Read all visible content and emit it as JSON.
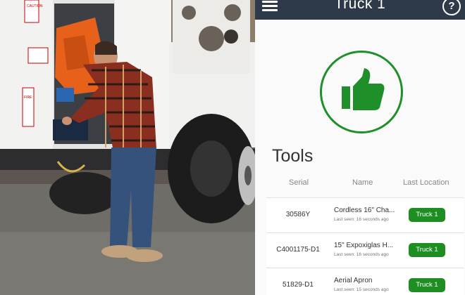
{
  "app": {
    "title": "Truck 1"
  },
  "truck_labels": {
    "caution": "CAUTION",
    "fire": "FIRE"
  },
  "tools": {
    "heading": "Tools",
    "columns": [
      "Serial",
      "Name",
      "Last Location"
    ],
    "rows": [
      {
        "serial": "30586Y",
        "name": "Cordless 16\" Cha...",
        "last_seen": "Last seen: 16 seconds ago",
        "location": "Truck 1"
      },
      {
        "serial": "C4001175-D1",
        "name": "15\" Expoxiglas H...",
        "last_seen": "Last seen: 16 seconds ago",
        "location": "Truck 1"
      },
      {
        "serial": "51829-D1",
        "name": "Aerial Apron",
        "last_seen": "Last seen: 15 seconds ago",
        "location": "Truck 1"
      }
    ]
  },
  "colors": {
    "accent_green": "#1e8e22",
    "app_bar": "#2e3a4a"
  },
  "icons": [
    "menu-icon",
    "help-icon",
    "thumbs-up-icon"
  ]
}
